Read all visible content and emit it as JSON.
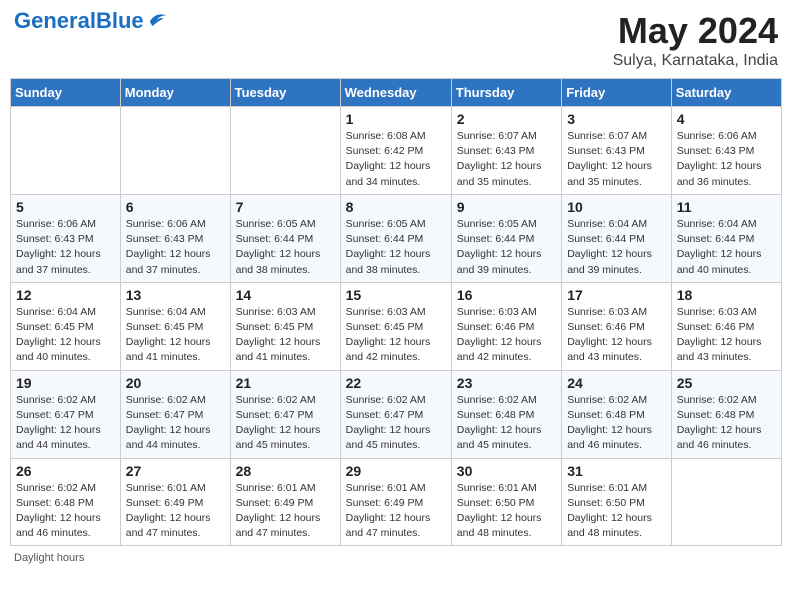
{
  "logo": {
    "general": "General",
    "blue": "Blue",
    "bird": "▶"
  },
  "title": "May 2024",
  "subtitle": "Sulya, Karnataka, India",
  "headers": [
    "Sunday",
    "Monday",
    "Tuesday",
    "Wednesday",
    "Thursday",
    "Friday",
    "Saturday"
  ],
  "weeks": [
    [
      {
        "day": "",
        "sunrise": "",
        "sunset": "",
        "daylight": ""
      },
      {
        "day": "",
        "sunrise": "",
        "sunset": "",
        "daylight": ""
      },
      {
        "day": "",
        "sunrise": "",
        "sunset": "",
        "daylight": ""
      },
      {
        "day": "1",
        "sunrise": "Sunrise: 6:08 AM",
        "sunset": "Sunset: 6:42 PM",
        "daylight": "Daylight: 12 hours and 34 minutes."
      },
      {
        "day": "2",
        "sunrise": "Sunrise: 6:07 AM",
        "sunset": "Sunset: 6:43 PM",
        "daylight": "Daylight: 12 hours and 35 minutes."
      },
      {
        "day": "3",
        "sunrise": "Sunrise: 6:07 AM",
        "sunset": "Sunset: 6:43 PM",
        "daylight": "Daylight: 12 hours and 35 minutes."
      },
      {
        "day": "4",
        "sunrise": "Sunrise: 6:06 AM",
        "sunset": "Sunset: 6:43 PM",
        "daylight": "Daylight: 12 hours and 36 minutes."
      }
    ],
    [
      {
        "day": "5",
        "sunrise": "Sunrise: 6:06 AM",
        "sunset": "Sunset: 6:43 PM",
        "daylight": "Daylight: 12 hours and 37 minutes."
      },
      {
        "day": "6",
        "sunrise": "Sunrise: 6:06 AM",
        "sunset": "Sunset: 6:43 PM",
        "daylight": "Daylight: 12 hours and 37 minutes."
      },
      {
        "day": "7",
        "sunrise": "Sunrise: 6:05 AM",
        "sunset": "Sunset: 6:44 PM",
        "daylight": "Daylight: 12 hours and 38 minutes."
      },
      {
        "day": "8",
        "sunrise": "Sunrise: 6:05 AM",
        "sunset": "Sunset: 6:44 PM",
        "daylight": "Daylight: 12 hours and 38 minutes."
      },
      {
        "day": "9",
        "sunrise": "Sunrise: 6:05 AM",
        "sunset": "Sunset: 6:44 PM",
        "daylight": "Daylight: 12 hours and 39 minutes."
      },
      {
        "day": "10",
        "sunrise": "Sunrise: 6:04 AM",
        "sunset": "Sunset: 6:44 PM",
        "daylight": "Daylight: 12 hours and 39 minutes."
      },
      {
        "day": "11",
        "sunrise": "Sunrise: 6:04 AM",
        "sunset": "Sunset: 6:44 PM",
        "daylight": "Daylight: 12 hours and 40 minutes."
      }
    ],
    [
      {
        "day": "12",
        "sunrise": "Sunrise: 6:04 AM",
        "sunset": "Sunset: 6:45 PM",
        "daylight": "Daylight: 12 hours and 40 minutes."
      },
      {
        "day": "13",
        "sunrise": "Sunrise: 6:04 AM",
        "sunset": "Sunset: 6:45 PM",
        "daylight": "Daylight: 12 hours and 41 minutes."
      },
      {
        "day": "14",
        "sunrise": "Sunrise: 6:03 AM",
        "sunset": "Sunset: 6:45 PM",
        "daylight": "Daylight: 12 hours and 41 minutes."
      },
      {
        "day": "15",
        "sunrise": "Sunrise: 6:03 AM",
        "sunset": "Sunset: 6:45 PM",
        "daylight": "Daylight: 12 hours and 42 minutes."
      },
      {
        "day": "16",
        "sunrise": "Sunrise: 6:03 AM",
        "sunset": "Sunset: 6:46 PM",
        "daylight": "Daylight: 12 hours and 42 minutes."
      },
      {
        "day": "17",
        "sunrise": "Sunrise: 6:03 AM",
        "sunset": "Sunset: 6:46 PM",
        "daylight": "Daylight: 12 hours and 43 minutes."
      },
      {
        "day": "18",
        "sunrise": "Sunrise: 6:03 AM",
        "sunset": "Sunset: 6:46 PM",
        "daylight": "Daylight: 12 hours and 43 minutes."
      }
    ],
    [
      {
        "day": "19",
        "sunrise": "Sunrise: 6:02 AM",
        "sunset": "Sunset: 6:47 PM",
        "daylight": "Daylight: 12 hours and 44 minutes."
      },
      {
        "day": "20",
        "sunrise": "Sunrise: 6:02 AM",
        "sunset": "Sunset: 6:47 PM",
        "daylight": "Daylight: 12 hours and 44 minutes."
      },
      {
        "day": "21",
        "sunrise": "Sunrise: 6:02 AM",
        "sunset": "Sunset: 6:47 PM",
        "daylight": "Daylight: 12 hours and 45 minutes."
      },
      {
        "day": "22",
        "sunrise": "Sunrise: 6:02 AM",
        "sunset": "Sunset: 6:47 PM",
        "daylight": "Daylight: 12 hours and 45 minutes."
      },
      {
        "day": "23",
        "sunrise": "Sunrise: 6:02 AM",
        "sunset": "Sunset: 6:48 PM",
        "daylight": "Daylight: 12 hours and 45 minutes."
      },
      {
        "day": "24",
        "sunrise": "Sunrise: 6:02 AM",
        "sunset": "Sunset: 6:48 PM",
        "daylight": "Daylight: 12 hours and 46 minutes."
      },
      {
        "day": "25",
        "sunrise": "Sunrise: 6:02 AM",
        "sunset": "Sunset: 6:48 PM",
        "daylight": "Daylight: 12 hours and 46 minutes."
      }
    ],
    [
      {
        "day": "26",
        "sunrise": "Sunrise: 6:02 AM",
        "sunset": "Sunset: 6:48 PM",
        "daylight": "Daylight: 12 hours and 46 minutes."
      },
      {
        "day": "27",
        "sunrise": "Sunrise: 6:01 AM",
        "sunset": "Sunset: 6:49 PM",
        "daylight": "Daylight: 12 hours and 47 minutes."
      },
      {
        "day": "28",
        "sunrise": "Sunrise: 6:01 AM",
        "sunset": "Sunset: 6:49 PM",
        "daylight": "Daylight: 12 hours and 47 minutes."
      },
      {
        "day": "29",
        "sunrise": "Sunrise: 6:01 AM",
        "sunset": "Sunset: 6:49 PM",
        "daylight": "Daylight: 12 hours and 47 minutes."
      },
      {
        "day": "30",
        "sunrise": "Sunrise: 6:01 AM",
        "sunset": "Sunset: 6:50 PM",
        "daylight": "Daylight: 12 hours and 48 minutes."
      },
      {
        "day": "31",
        "sunrise": "Sunrise: 6:01 AM",
        "sunset": "Sunset: 6:50 PM",
        "daylight": "Daylight: 12 hours and 48 minutes."
      },
      {
        "day": "",
        "sunrise": "",
        "sunset": "",
        "daylight": ""
      }
    ]
  ],
  "footer": "Daylight hours"
}
